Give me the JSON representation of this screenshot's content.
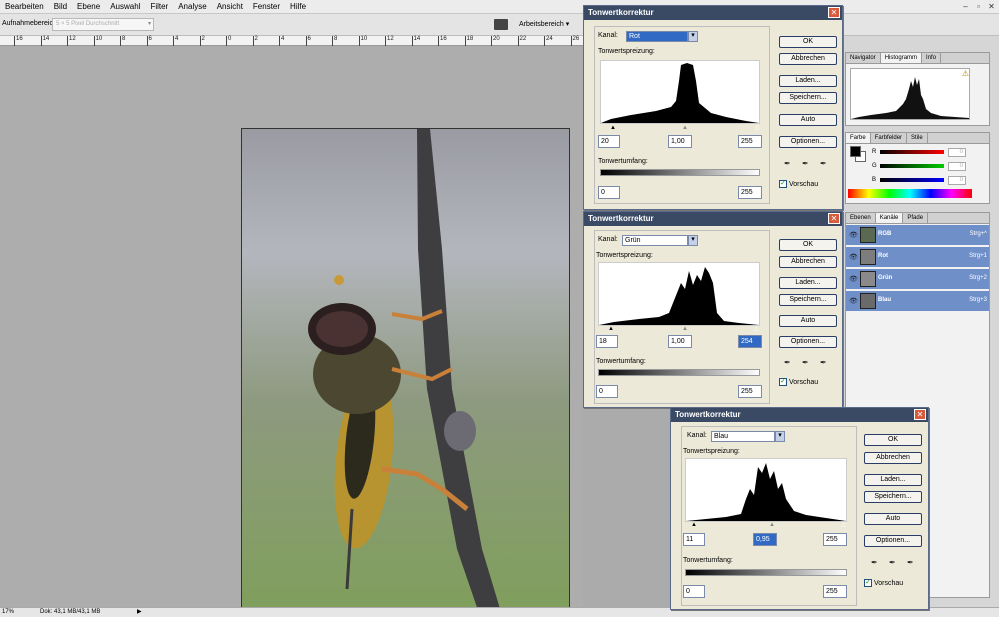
{
  "menu": [
    "Bearbeiten",
    "Bild",
    "Ebene",
    "Auswahl",
    "Filter",
    "Analyse",
    "Ansicht",
    "Fenster",
    "Hilfe"
  ],
  "window_controls": [
    "–",
    "▫",
    "✕"
  ],
  "optbar": {
    "label": "Aufnahmebereich:",
    "sample_value": "5 × 5 Pixel Durchschnitt",
    "workspace": "Arbeitsbereich ▾"
  },
  "ruler_ticks": [
    "16",
    "14",
    "12",
    "10",
    "8",
    "6",
    "4",
    "2",
    "0",
    "2",
    "4",
    "6",
    "8",
    "10",
    "12",
    "14",
    "16",
    "18",
    "20",
    "22",
    "24",
    "26"
  ],
  "status": {
    "zoom": "17%",
    "doc": "Dok: 43,1 MB/43,1 MB",
    "arrow": "▶"
  },
  "panels": {
    "nav_tabs": [
      "Navigator",
      "Histogramm",
      "Info"
    ],
    "color_tabs": [
      "Farbe",
      "Farbfelder",
      "Stile"
    ],
    "color_labels": [
      "R",
      "G",
      "B"
    ],
    "color_values": [
      "0",
      "0",
      "0"
    ],
    "layers_tabs": [
      "Ebenen",
      "Kanäle",
      "Pfade"
    ],
    "channels": [
      {
        "name": "RGB",
        "key": "Strg+^"
      },
      {
        "name": "Rot",
        "key": "Strg+1"
      },
      {
        "name": "Grün",
        "key": "Strg+2"
      },
      {
        "name": "Blau",
        "key": "Strg+3"
      }
    ]
  },
  "dialogs": [
    {
      "title": "Tonwertkorrektur",
      "kanal_label": "Kanal:",
      "kanal_value": "Rot",
      "spreizung": "Tonwertspreizung:",
      "inputs": [
        "20",
        "1,00",
        "255"
      ],
      "umfang": "Tonwertumfang:",
      "outputs": [
        "0",
        "255"
      ],
      "buttons": [
        "OK",
        "Abbrechen",
        "Laden...",
        "Speichern...",
        "Auto",
        "Optionen..."
      ],
      "vorschau": "Vorschau"
    },
    {
      "title": "Tonwertkorrektur",
      "kanal_label": "Kanal:",
      "kanal_value": "Grün",
      "spreizung": "Tonwertspreizung:",
      "inputs": [
        "18",
        "1,00",
        "254"
      ],
      "umfang": "Tonwertumfang:",
      "outputs": [
        "0",
        "255"
      ],
      "buttons": [
        "OK",
        "Abbrechen",
        "Laden...",
        "Speichern...",
        "Auto",
        "Optionen..."
      ],
      "vorschau": "Vorschau"
    },
    {
      "title": "Tonwertkorrektur",
      "kanal_label": "Kanal:",
      "kanal_value": "Blau",
      "spreizung": "Tonwertspreizung:",
      "inputs": [
        "11",
        "0,95",
        "255"
      ],
      "umfang": "Tonwertumfang:",
      "outputs": [
        "0",
        "255"
      ],
      "buttons": [
        "OK",
        "Abbrechen",
        "Laden...",
        "Speichern...",
        "Auto",
        "Optionen..."
      ],
      "vorschau": "Vorschau"
    }
  ]
}
